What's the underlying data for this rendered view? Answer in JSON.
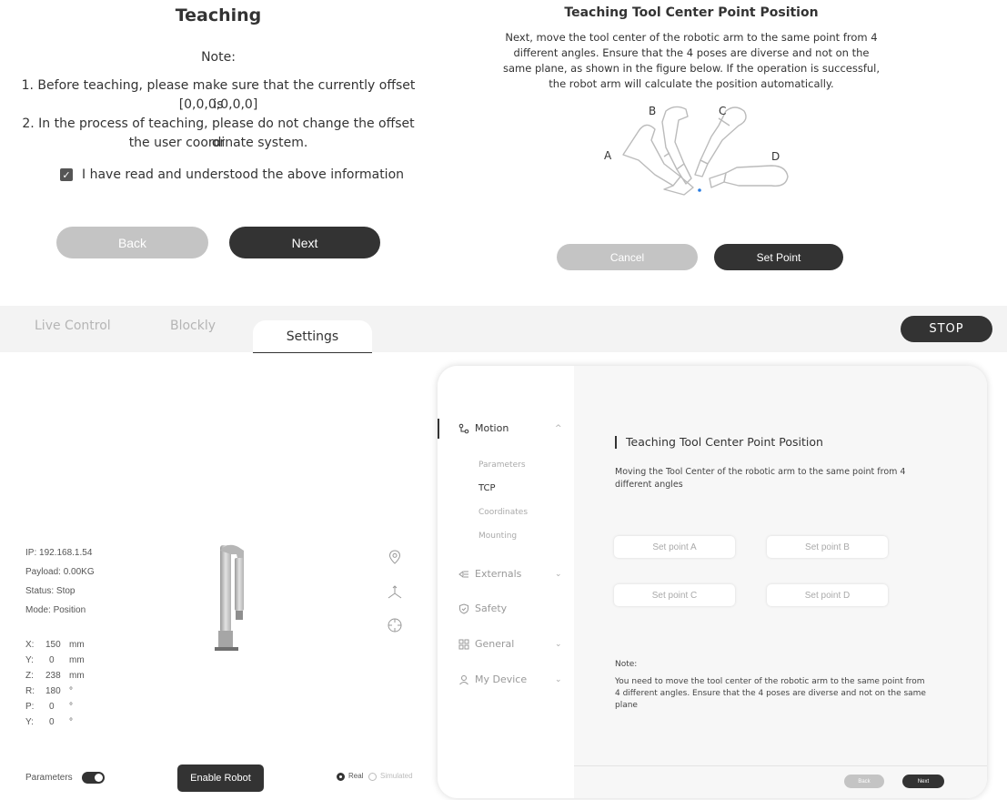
{
  "teaching_dialog": {
    "title": "Teaching",
    "note_heading": "Note:",
    "note_lines": [
      "1. Before teaching, please make sure that the currently offset is",
      "[0,0,0,0,0,0]",
      "2. In the process of teaching, please do not change the offset or",
      "the user coordinate system."
    ],
    "checkbox_label": "I have read and understood the above information",
    "checkbox_checked": true,
    "back_label": "Back",
    "next_label": "Next"
  },
  "tcp_dialog": {
    "title": "Teaching Tool Center Point Position",
    "description": "Next, move the tool center of the robotic arm to the same point from 4 different angles. Ensure that the 4 poses are diverse and not on the same plane, as shown in the figure below. If the operation is successful, the robot arm will calculate the position automatically.",
    "figure_labels": [
      "A",
      "B",
      "C",
      "D"
    ],
    "cancel_label": "Cancel",
    "set_point_label": "Set Point"
  },
  "tabs": {
    "items": [
      "Live Control",
      "Blockly",
      "Settings"
    ],
    "active": "Settings",
    "stop_label": "STOP"
  },
  "robot_info": {
    "ip": "IP: 192.168.1.54",
    "payload": "Payload: 0.00KG",
    "status": "Status: Stop",
    "mode": "Mode: Position",
    "positions": [
      {
        "axis": "X:",
        "value": "150",
        "unit": "mm"
      },
      {
        "axis": "Y:",
        "value": "0",
        "unit": "mm"
      },
      {
        "axis": "Z:",
        "value": "238",
        "unit": "mm"
      },
      {
        "axis": "R:",
        "value": "180",
        "unit": "°"
      },
      {
        "axis": "P:",
        "value": "0",
        "unit": "°"
      },
      {
        "axis": "Y:",
        "value": "0",
        "unit": "°"
      }
    ]
  },
  "bottom_controls": {
    "parameters_label": "Parameters",
    "parameters_on": true,
    "enable_label": "Enable Robot",
    "real_label": "Real",
    "simulated_label": "Simulated",
    "selected_mode": "Real"
  },
  "settings_nav": {
    "motion_label": "Motion",
    "motion_sub": [
      "Parameters",
      "TCP",
      "Coordinates",
      "Mounting"
    ],
    "motion_sub_active": "TCP",
    "externals_label": "Externals",
    "safety_label": "Safety",
    "general_label": "General",
    "my_device_label": "My Device"
  },
  "settings_main": {
    "title": "Teaching Tool Center Point Position",
    "description": "Moving the Tool Center of the robotic arm to the same point from 4 different angles",
    "set_points": [
      "Set point A",
      "Set point B",
      "Set point C",
      "Set point D"
    ],
    "note_heading": "Note:",
    "note_text": "You need to move the tool center of the robotic arm to the same point from 4 different angles. Ensure that the 4 poses are diverse and not on the same plane",
    "back_label": "Back",
    "next_label": "Next"
  },
  "colors": {
    "dark": "#333333",
    "grey_button": "#c4c4c4",
    "tabbar_bg": "#f3f3f3",
    "panel_main_bg": "#f7f7f7"
  }
}
